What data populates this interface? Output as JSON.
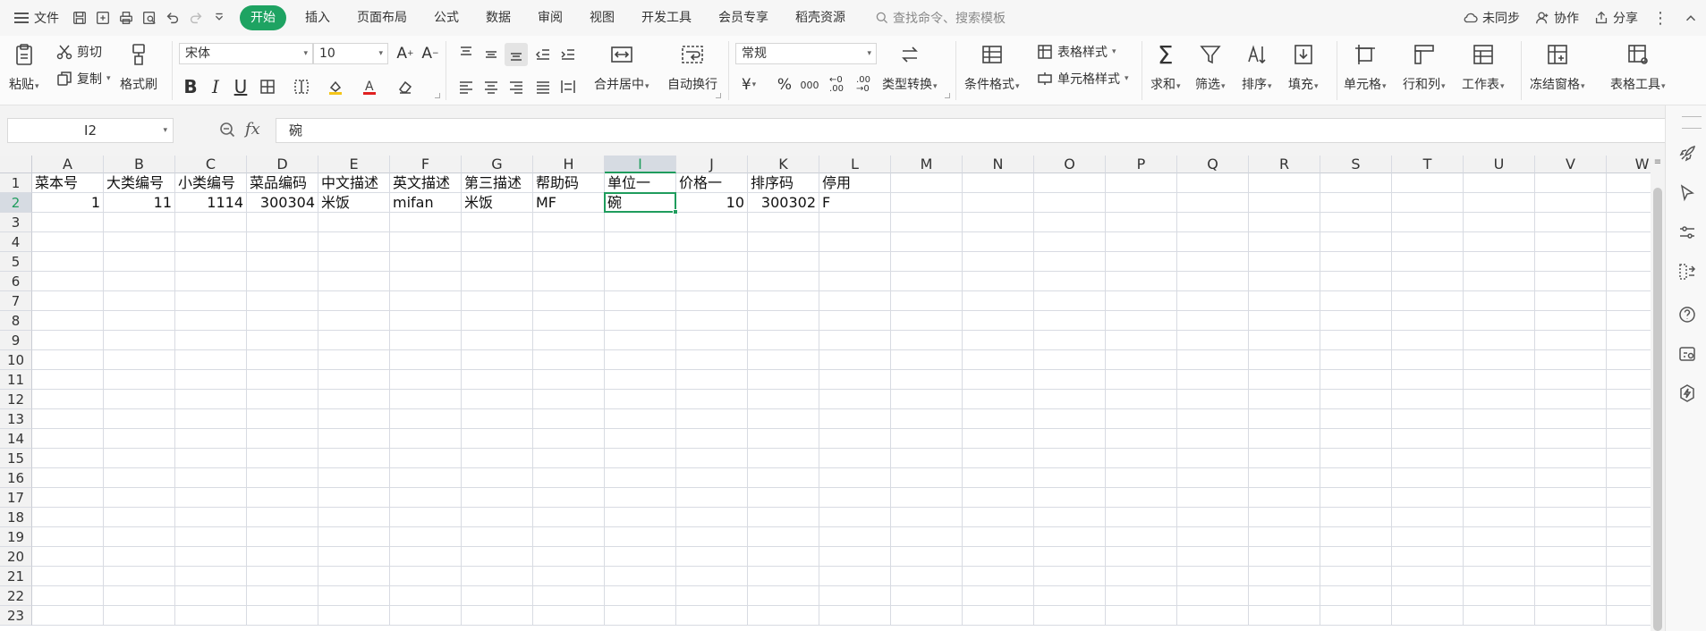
{
  "menu": {
    "file_label": "文件",
    "tabs": [
      "开始",
      "插入",
      "页面布局",
      "公式",
      "数据",
      "审阅",
      "视图",
      "开发工具",
      "会员专享",
      "稻壳资源"
    ],
    "search_placeholder": "查找命令、搜索模板",
    "sync_label": "未同步",
    "collab_label": "协作",
    "share_label": "分享"
  },
  "ribbon": {
    "paste": "粘贴",
    "cut": "剪切",
    "copy": "复制",
    "format_painter": "格式刷",
    "font_name": "宋体",
    "font_size": "10",
    "merge_center": "合并居中",
    "wrap_text": "自动换行",
    "number_format": "常规",
    "type_convert": "类型转换",
    "conditional_format": "条件格式",
    "table_style": "表格样式",
    "cell_style": "单元格样式",
    "sum": "求和",
    "filter": "筛选",
    "sort": "排序",
    "fill": "填充",
    "cell": "单元格",
    "row_col": "行和列",
    "worksheet": "工作表",
    "freeze": "冻结窗格",
    "table_tools": "表格工具"
  },
  "formula_bar": {
    "cell_ref": "I2",
    "fx": "fx",
    "content": "碗"
  },
  "sheet": {
    "columns": [
      "A",
      "B",
      "C",
      "D",
      "E",
      "F",
      "G",
      "H",
      "I",
      "J",
      "K",
      "L",
      "M",
      "N",
      "O",
      "P",
      "Q",
      "R",
      "S",
      "T",
      "U",
      "V",
      "W"
    ],
    "rows": [
      "1",
      "2",
      "3",
      "4",
      "5",
      "6",
      "7",
      "8",
      "9",
      "10",
      "11",
      "12",
      "13",
      "14",
      "15",
      "16",
      "17",
      "18",
      "19",
      "20",
      "21",
      "22",
      "23"
    ],
    "header_row": [
      "菜本号",
      "大类编号",
      "小类编号",
      "菜品编码",
      "中文描述",
      "英文描述",
      "第三描述",
      "帮助码",
      "单位一",
      "价格一",
      "排序码",
      "停用"
    ],
    "data_row": [
      "1",
      "11",
      "1114",
      "300304",
      "米饭",
      "mifan",
      "米饭",
      "MF",
      "碗",
      "10",
      "300302",
      "F"
    ],
    "selected_column": "I",
    "selected_row": "2"
  }
}
